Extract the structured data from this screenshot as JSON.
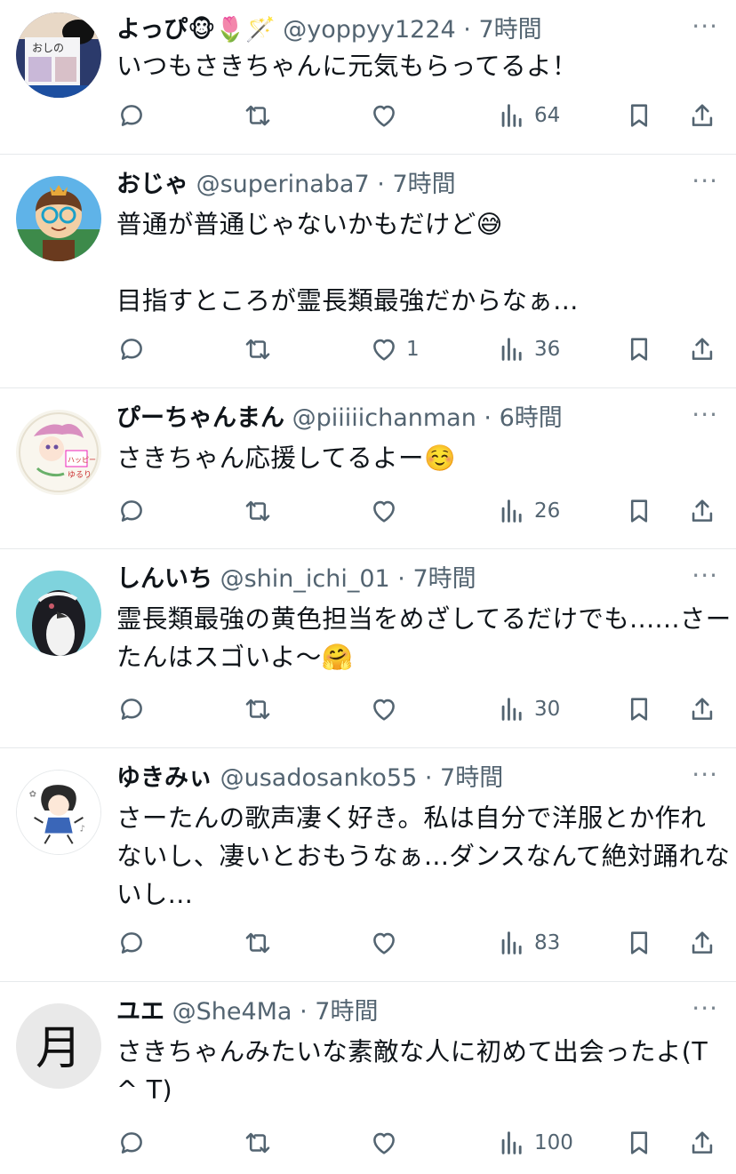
{
  "tweets": [
    {
      "name": "よっぴ🐵🌷🪄",
      "handle": "@yoppyy1224",
      "dot": "·",
      "time": "7時間",
      "text": "いつもさきちゃんに元気もらってるよ！",
      "likes": "",
      "views": "64",
      "avatar": "avatar-oshi-photo"
    },
    {
      "name": "おじゃ",
      "handle": "@superinaba7",
      "dot": "·",
      "time": "7時間",
      "text": "普通が普通じゃないかもだけど😅\n\n目指すところが霊長類最強だからなぁ...",
      "likes": "1",
      "views": "36",
      "avatar": "avatar-glasses-character"
    },
    {
      "name": "ぴーちゃんまん",
      "handle": "@piiiiichanman",
      "dot": "·",
      "time": "6時間",
      "text": "さきちゃん応援してるよー☺️",
      "likes": "",
      "views": "26",
      "avatar": "avatar-illustration"
    },
    {
      "name": "しんいち",
      "handle": "@shin_ichi_01",
      "dot": "·",
      "time": "7時間",
      "text": "霊長類最強の黄色担当をめざしてるだけでも......さーたんはスゴいよ〜🤗",
      "likes": "",
      "views": "30",
      "avatar": "avatar-penguin"
    },
    {
      "name": "ゆきみぃ",
      "handle": "@usadosanko55",
      "dot": "·",
      "time": "7時間",
      "text": "さーたんの歌声凄く好き。私は自分で洋服とか作れないし、凄いとおもうなぁ...ダンスなんて絶対踊れないし...",
      "likes": "",
      "views": "83",
      "avatar": "avatar-girl-drawing"
    },
    {
      "name": "ユエ",
      "handle": "@She4Ma",
      "dot": "·",
      "time": "7時間",
      "text": "さきちゃんみたいな素敵な人に初めて出会ったよ(T ^ T)",
      "likes": "",
      "views": "100",
      "avatar": "avatar-moon-kanji"
    }
  ],
  "more_glyph": "···",
  "icons": {
    "reply": "reply-icon",
    "retweet": "retweet-icon",
    "like": "heart-icon",
    "views": "views-icon",
    "bookmark": "bookmark-icon",
    "share": "share-icon"
  },
  "colors": {
    "text": "#0f1419",
    "secondary": "#536471",
    "divider": "#e6e9eb"
  }
}
